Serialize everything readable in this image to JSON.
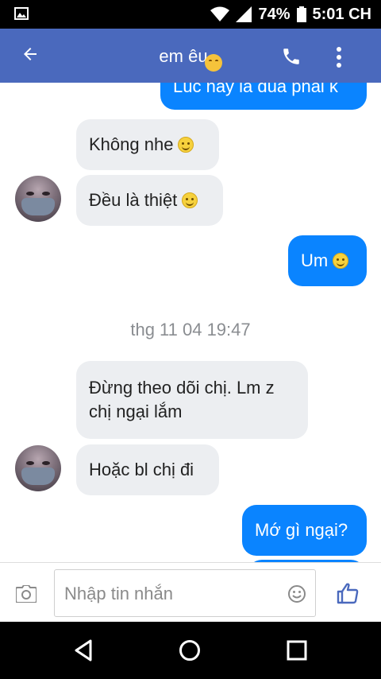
{
  "status_bar": {
    "battery": "74%",
    "time": "5:01 CH"
  },
  "header": {
    "title": "em êu",
    "icons": {
      "back": "arrow-left-icon",
      "call": "phone-icon",
      "menu": "more-vertical-icon"
    }
  },
  "messages": [
    {
      "direction": "outgoing",
      "text": "Lúc nãy là đùa phải k"
    },
    {
      "direction": "incoming",
      "text": "Không nhe"
    },
    {
      "direction": "incoming",
      "text": "Đều là thiệt"
    },
    {
      "direction": "outgoing",
      "text": "Um"
    },
    {
      "direction": "incoming",
      "text": "Đừng theo dõi chị. Lm z chị ngại lắm"
    },
    {
      "direction": "incoming",
      "text": "Hoặc bl chị đi"
    },
    {
      "direction": "outgoing",
      "text": "Mớ gì ngại?"
    }
  ],
  "timestamp": "thg 11 04 19:47",
  "composer": {
    "placeholder": "Nhập tin nhắn"
  },
  "colors": {
    "header": "#4a69bd",
    "outgoing_bubble": "#0a84ff",
    "incoming_bubble": "#eceef1"
  }
}
